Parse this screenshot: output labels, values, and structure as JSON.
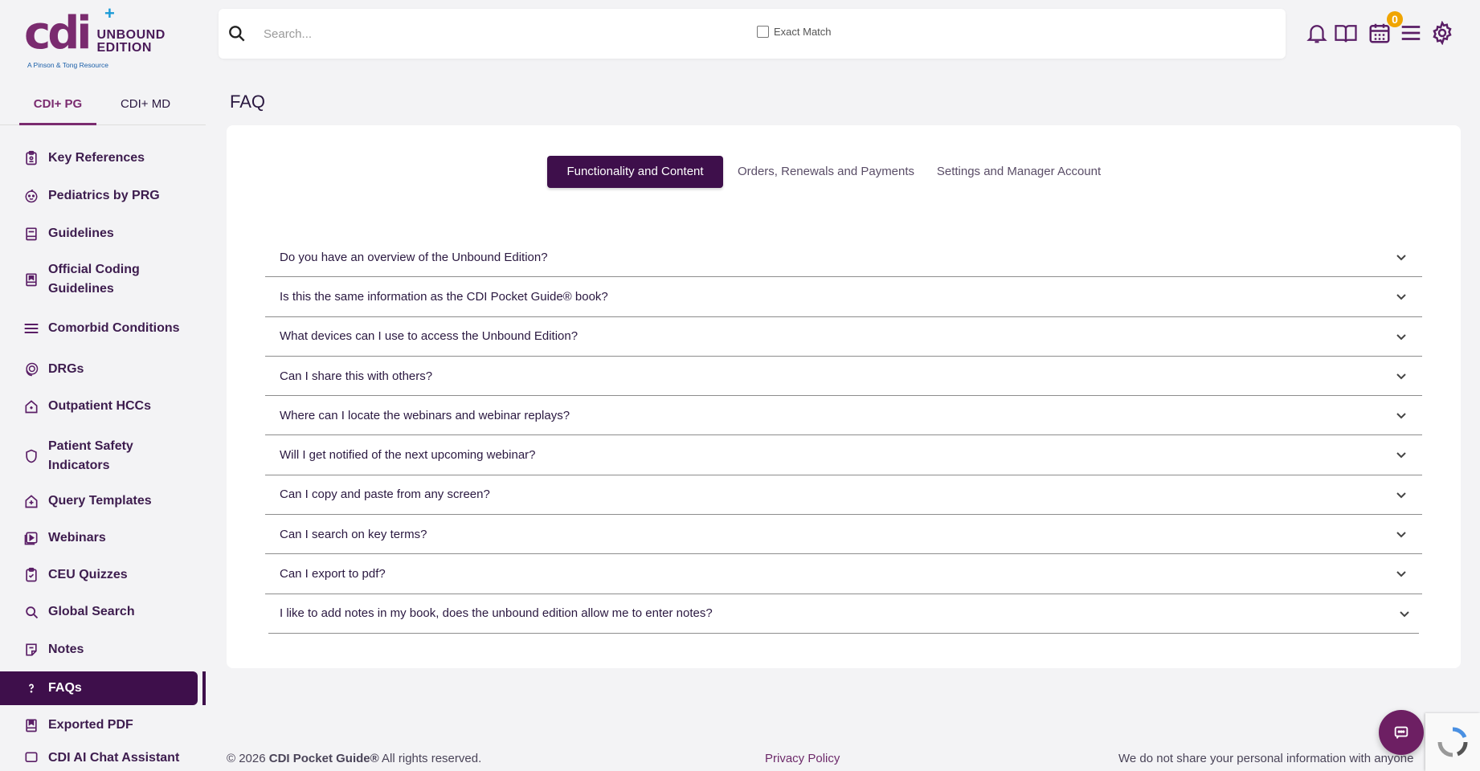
{
  "brand": {
    "logo_mark": "cdi",
    "logo_line1": "UNBOUND",
    "logo_line2": "EDITION",
    "logo_sub": "A Pinson & Tong Resource",
    "primary_color": "#3e0f4b",
    "accent_color": "#7a2b6f"
  },
  "product_tabs": [
    {
      "label": "CDI+ PG",
      "active": true
    },
    {
      "label": "CDI+ MD",
      "active": false
    }
  ],
  "sidebar": {
    "items": [
      {
        "label": "Key References",
        "icon": "clipboard-icon"
      },
      {
        "label": "Pediatrics by PRG",
        "icon": "baby-face-icon"
      },
      {
        "label": "Guidelines",
        "icon": "book-icon"
      },
      {
        "label": "Official Coding",
        "label2": "Guidelines",
        "icon": "bookmark-book-icon"
      },
      {
        "label": "Comorbid Conditions",
        "icon": "list-icon"
      },
      {
        "label": "DRGs",
        "icon": "coins-icon"
      },
      {
        "label": "Outpatient HCCs",
        "icon": "house-icon"
      },
      {
        "label": "Patient Safety",
        "label2": "Indicators",
        "icon": "shield-icon"
      },
      {
        "label": "Query Templates",
        "icon": "house-plus-icon"
      },
      {
        "label": "Webinars",
        "icon": "video-icon"
      },
      {
        "label": "CEU Quizzes",
        "icon": "quiz-icon"
      },
      {
        "label": "Global Search",
        "icon": "search-icon"
      },
      {
        "label": "Notes",
        "icon": "note-icon"
      },
      {
        "label": "FAQs",
        "icon": "question-icon",
        "active": true
      },
      {
        "label": "Exported PDF",
        "icon": "pdf-book-icon"
      },
      {
        "label": "CDI AI Chat Assistant",
        "icon": "chat-icon"
      }
    ]
  },
  "search": {
    "placeholder": "Search...",
    "exact_match_label": "Exact Match"
  },
  "header": {
    "calendar_badge": "0"
  },
  "main": {
    "title": "FAQ",
    "tabs": [
      {
        "label": "Functionality and Content",
        "active": true
      },
      {
        "label": "Orders, Renewals and Payments",
        "active": false
      },
      {
        "label": "Settings and Manager Account",
        "active": false
      }
    ],
    "faqs": [
      "Do you have an overview of the Unbound Edition?",
      "Is this the same information as the CDI Pocket Guide® book?",
      "What devices can I use to access the Unbound Edition?",
      "Can I share this with others?",
      "Where can I locate the webinars and webinar replays?",
      "Will I get notified of the next upcoming webinar?",
      "Can I copy and paste from any screen?",
      "Can I search on key terms?",
      "Can I export to pdf?",
      "I like to add notes in my book, does the unbound edition allow me to enter notes?"
    ]
  },
  "footer": {
    "copyright_prefix": "© 2026 ",
    "copyright_brand": "CDI Pocket Guide®",
    "copyright_suffix": " All rights reserved.",
    "privacy": "Privacy Policy",
    "notice": "We do not share your personal information with anyone"
  }
}
